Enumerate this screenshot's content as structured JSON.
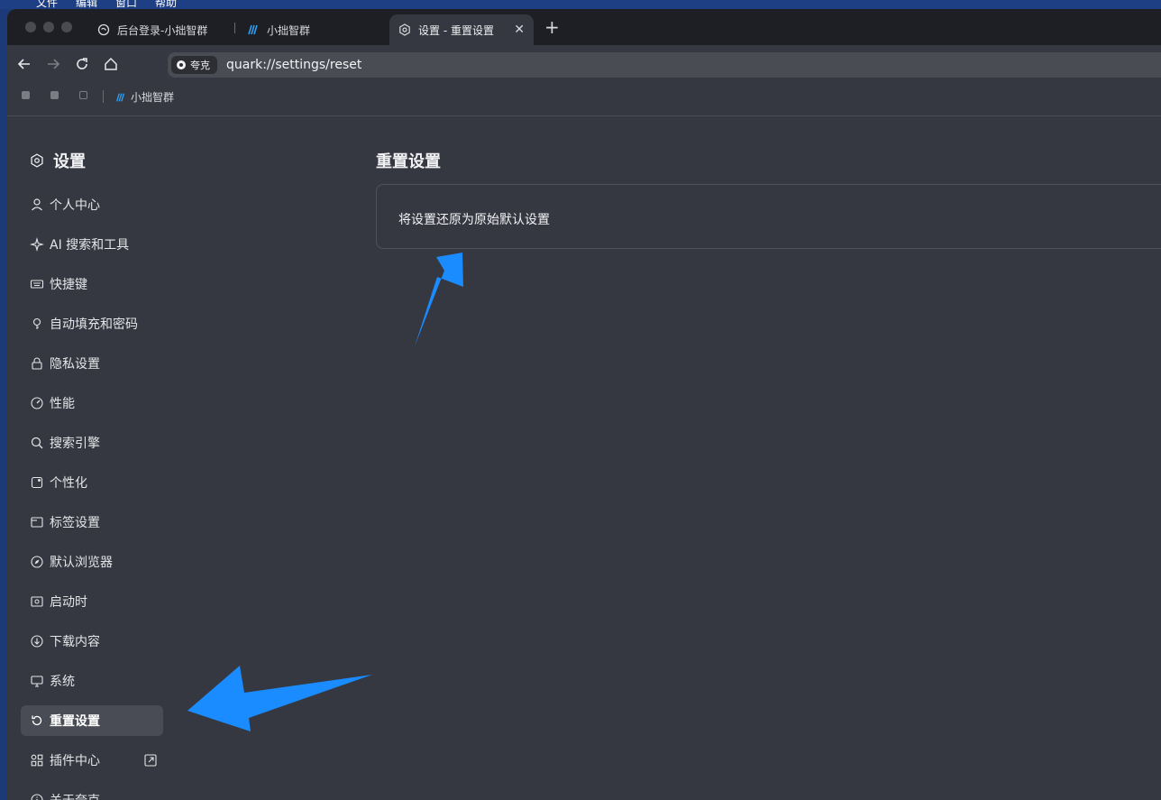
{
  "menubar": {
    "items": [
      "文件",
      "编辑",
      "窗口",
      "帮助"
    ]
  },
  "tabs": [
    {
      "label": "后台登录-小拙智群",
      "icon": "chat-icon"
    },
    {
      "label": "小拙智群",
      "icon": "wave-logo-icon"
    },
    {
      "label": "设置 - 重置设置",
      "icon": "settings-icon",
      "active": true
    }
  ],
  "address": {
    "badge": "夸克",
    "url": "quark://settings/reset"
  },
  "bookmarks": {
    "items": [
      {
        "label": "小拙智群"
      }
    ]
  },
  "sidebar": {
    "title": "设置",
    "items": [
      {
        "label": "个人中心",
        "icon": "user-icon"
      },
      {
        "label": "AI 搜索和工具",
        "icon": "sparkle-icon"
      },
      {
        "label": "快捷键",
        "icon": "keyboard-icon"
      },
      {
        "label": "自动填充和密码",
        "icon": "key-icon"
      },
      {
        "label": "隐私设置",
        "icon": "lock-icon"
      },
      {
        "label": "性能",
        "icon": "gauge-icon"
      },
      {
        "label": "搜索引擎",
        "icon": "search-icon"
      },
      {
        "label": "个性化",
        "icon": "palette-icon"
      },
      {
        "label": "标签设置",
        "icon": "tab-icon"
      },
      {
        "label": "默认浏览器",
        "icon": "compass-icon"
      },
      {
        "label": "启动时",
        "icon": "startup-icon"
      },
      {
        "label": "下载内容",
        "icon": "download-icon"
      },
      {
        "label": "系统",
        "icon": "monitor-icon"
      },
      {
        "label": "重置设置",
        "icon": "reset-icon",
        "active": true
      },
      {
        "label": "插件中心",
        "icon": "grid-icon"
      },
      {
        "label": "关于夸克",
        "icon": "info-icon"
      }
    ]
  },
  "main": {
    "title": "重置设置",
    "card": {
      "text": "将设置还原为原始默认设置"
    }
  },
  "colors": {
    "accent_arrow": "#1a8cff",
    "background": "#353841"
  }
}
